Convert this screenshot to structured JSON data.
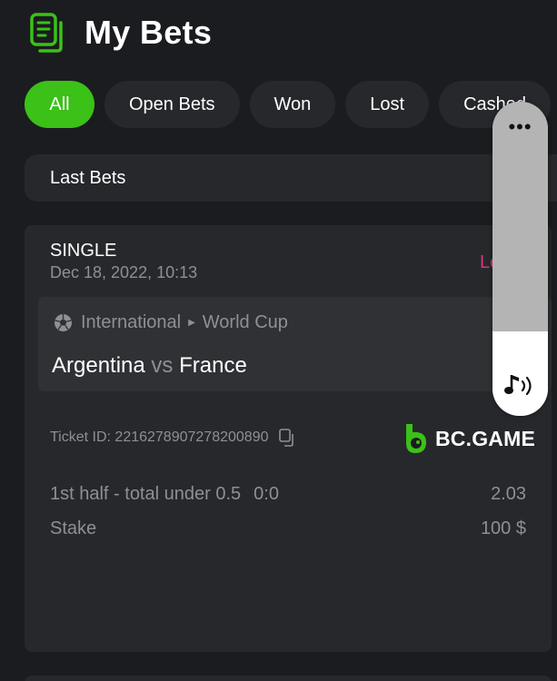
{
  "header": {
    "title": "My Bets",
    "icon": "bets-list-icon"
  },
  "tabs": [
    {
      "label": "All",
      "active": true
    },
    {
      "label": "Open Bets",
      "active": false
    },
    {
      "label": "Won",
      "active": false
    },
    {
      "label": "Lost",
      "active": false
    },
    {
      "label": "Cashed",
      "active": false
    }
  ],
  "section": {
    "title": "Last Bets"
  },
  "bet": {
    "type": "SINGLE",
    "datetime": "Dec 18, 2022, 10:13",
    "status": "Lost",
    "league": {
      "category": "International",
      "competition": "World Cup",
      "icon": "soccer-ball-icon"
    },
    "teams": {
      "home": "Argentina",
      "vs": "vs",
      "away": "France"
    },
    "ticket_id_label": "Ticket ID: 2216278907278200890",
    "brand": "BC.GAME",
    "market": "1st half - total under 0.5",
    "score": "0:0",
    "odds": "2.03",
    "stake_label": "Stake",
    "stake": "100 $"
  },
  "overlay": {
    "more": "•••",
    "icon": "sound-icon"
  },
  "colors": {
    "accent": "#3bc117",
    "lost": "#e0317d",
    "background": "#1b1c1f",
    "card": "#26282c"
  }
}
